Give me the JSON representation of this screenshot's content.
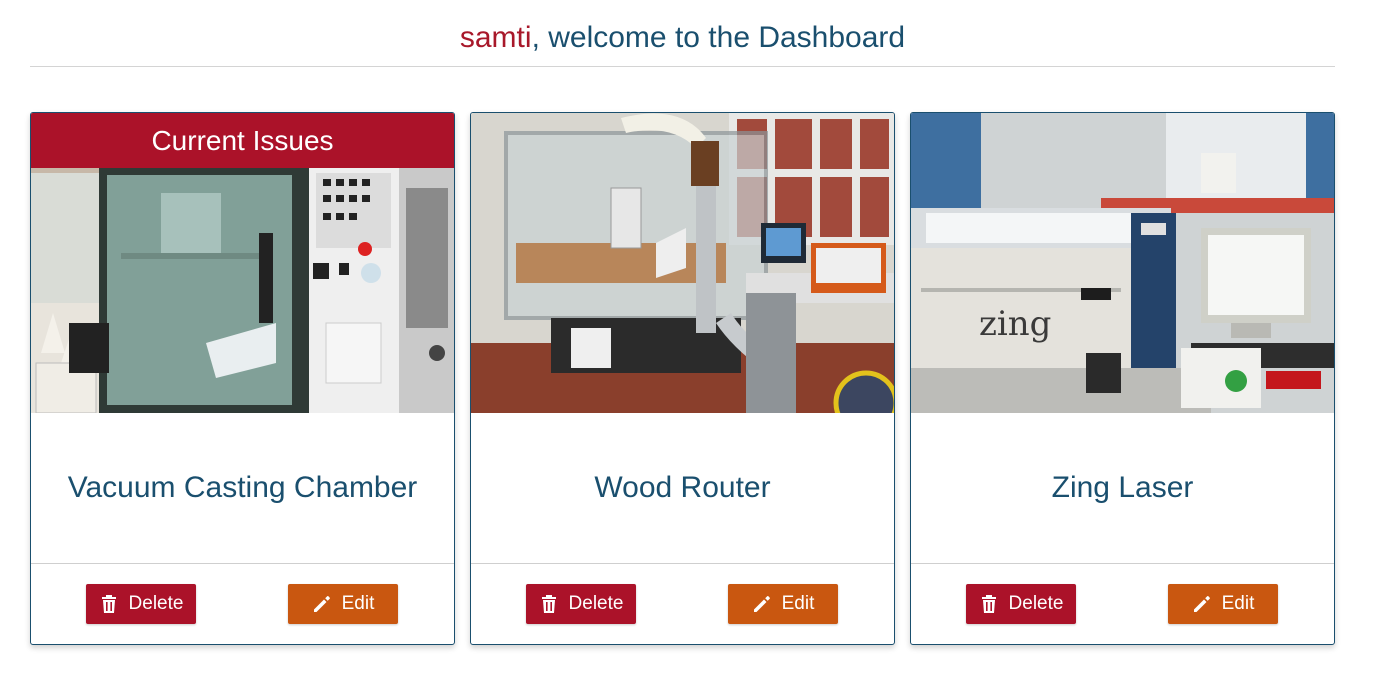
{
  "header": {
    "username": "samti",
    "welcome_text": ", welcome to the Dashboard"
  },
  "colors": {
    "accent_red": "#ab1229",
    "accent_orange": "#c95710",
    "primary_blue": "#1a4f6e"
  },
  "cards": [
    {
      "name": "Vacuum Casting Chamber",
      "badge": "Current Issues",
      "delete_label": "Delete",
      "edit_label": "Edit",
      "delete_icon": "trash-icon",
      "edit_icon": "pencil-icon"
    },
    {
      "name": "Wood Router",
      "delete_label": "Delete",
      "edit_label": "Edit",
      "delete_icon": "trash-icon",
      "edit_icon": "pencil-icon"
    },
    {
      "name": "Zing Laser",
      "delete_label": "Delete",
      "edit_label": "Edit",
      "delete_icon": "trash-icon",
      "edit_icon": "pencil-icon"
    }
  ]
}
